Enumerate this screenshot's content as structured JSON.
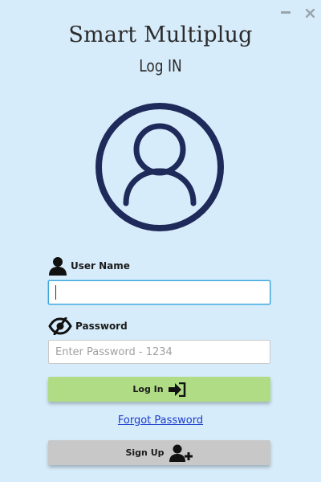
{
  "window": {
    "minimize_icon": "minimize-icon",
    "close_icon": "close-icon"
  },
  "header": {
    "title": "Smart Multiplug",
    "subtitle": "Log IN"
  },
  "avatar": {
    "icon": "user-circle-icon",
    "color": "#1e2a5a"
  },
  "form": {
    "username_label": "User Name",
    "username_icon": "user-icon",
    "username_value": "",
    "password_label": "Password",
    "password_icon": "eye-slash-icon",
    "password_placeholder": "Enter Password - 1234"
  },
  "actions": {
    "login_label": "Log In",
    "login_icon": "sign-in-icon",
    "forgot_label": "Forgot Password",
    "signup_label": "Sign Up",
    "signup_icon": "user-plus-icon"
  },
  "colors": {
    "background": "#d7ecfb",
    "login_button": "#b0dc85",
    "signup_button": "#c8c8c8",
    "link": "#1a3ccc",
    "focus_border": "#3ba4d8"
  }
}
